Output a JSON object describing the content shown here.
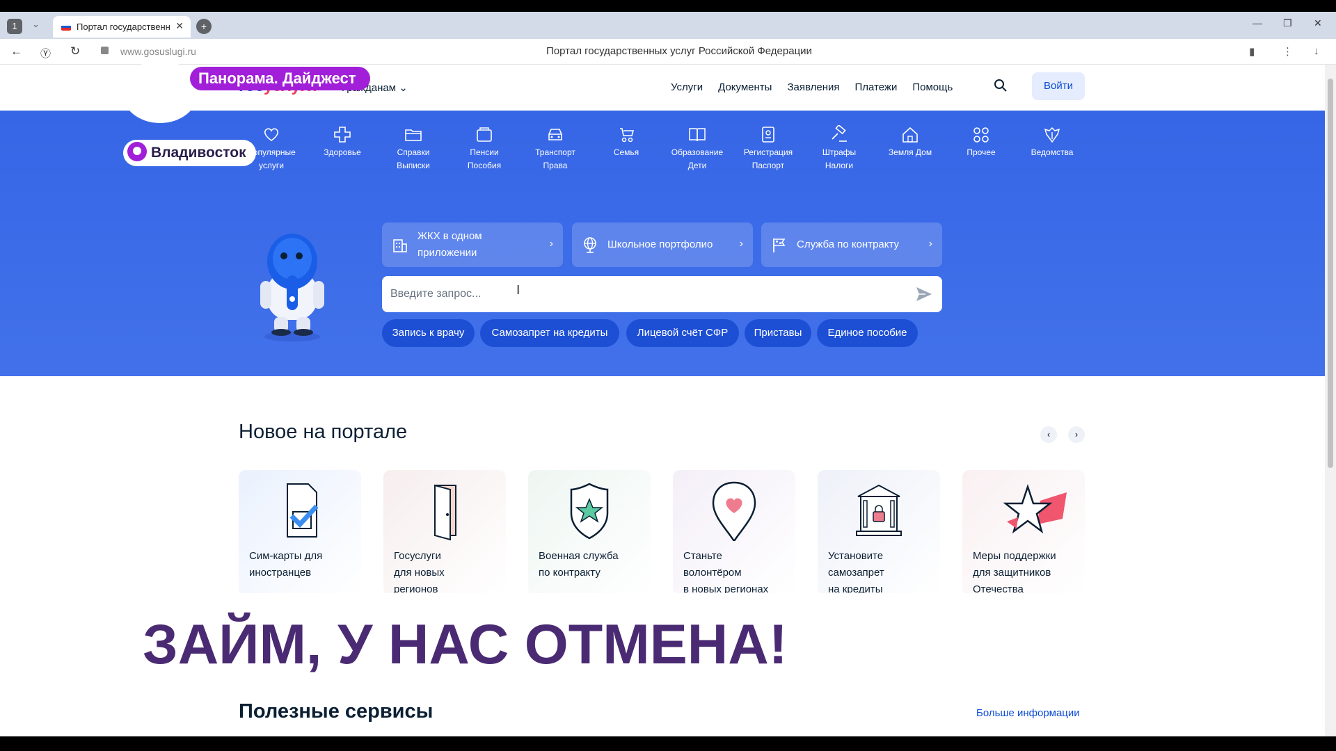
{
  "browser": {
    "tab_count": "1",
    "tab_title": "Портал государственн",
    "url": "www.gosuslugi.ru",
    "page_title": "Портал государственных услуг Российской Федерации"
  },
  "overlay": {
    "show_name": "Панорама. Дайджест",
    "city": "Владивосток",
    "headline": "ЗАЙМ, У НАС ОТМЕНА!"
  },
  "header": {
    "logo_part1": "гос",
    "logo_part2": "услуги",
    "audience": "Гражданам",
    "nav": [
      "Услуги",
      "Документы",
      "Заявления",
      "Платежи",
      "Помощь"
    ],
    "login": "Войти"
  },
  "categories": [
    {
      "line1": "Популярные",
      "line2": "услуги",
      "icon": "heart-icon"
    },
    {
      "line1": "Здоровье",
      "line2": "",
      "icon": "health-cross-icon"
    },
    {
      "line1": "Справки",
      "line2": "Выписки",
      "icon": "folder-icon"
    },
    {
      "line1": "Пенсии",
      "line2": "Пособия",
      "icon": "wallet-icon"
    },
    {
      "line1": "Транспорт",
      "line2": "Права",
      "icon": "car-icon"
    },
    {
      "line1": "Семья",
      "line2": "",
      "icon": "stroller-icon"
    },
    {
      "line1": "Образование",
      "line2": "Дети",
      "icon": "book-icon"
    },
    {
      "line1": "Регистрация",
      "line2": "Паспорт",
      "icon": "passport-icon"
    },
    {
      "line1": "Штрафы",
      "line2": "Налоги",
      "icon": "gavel-icon"
    },
    {
      "line1": "Земля Дом",
      "line2": "",
      "icon": "house-icon"
    },
    {
      "line1": "Прочее",
      "line2": "",
      "icon": "grid-icon"
    },
    {
      "line1": "Ведомства",
      "line2": "",
      "icon": "emblem-icon"
    }
  ],
  "promos": [
    {
      "line1": "ЖКХ в одном",
      "line2": "приложении",
      "icon": "building-icon"
    },
    {
      "line1": "Школьное портфолио",
      "line2": "",
      "icon": "globe-icon"
    },
    {
      "line1": "Служба по контракту",
      "line2": "",
      "icon": "flag-icon"
    }
  ],
  "search": {
    "placeholder": "Введите запрос..."
  },
  "quick_chips": [
    "Запись к врачу",
    "Самозапрет на кредиты",
    "Лицевой счёт СФР",
    "Приставы",
    "Единое пособие"
  ],
  "news": {
    "title": "Новое на портале",
    "cards": [
      {
        "lines": [
          "Сим-карты для",
          "иностранцев",
          ""
        ],
        "bg": "#eaf1fd",
        "icon": "sim-card-icon"
      },
      {
        "lines": [
          "Госуслуги",
          "для новых",
          "регионов"
        ],
        "bg": "#f7eeee",
        "icon": "door-icon"
      },
      {
        "lines": [
          "Военная служба",
          "по контракту",
          ""
        ],
        "bg": "#eef6f2",
        "icon": "shield-star-icon"
      },
      {
        "lines": [
          "Станьте",
          "волонтёром",
          "в новых регионах"
        ],
        "bg": "#f4eff8",
        "icon": "heart-pin-icon"
      },
      {
        "lines": [
          "Установите",
          "самозапрет",
          "на кредиты"
        ],
        "bg": "#eef1f9",
        "icon": "bank-lock-icon"
      },
      {
        "lines": [
          "Меры поддержки",
          "для защитников",
          "Отечества"
        ],
        "bg": "#f9f0f2",
        "icon": "star-ribbon-icon"
      }
    ]
  },
  "useful": {
    "title": "Полезные сервисы",
    "more": "Больше информации"
  },
  "colors": {
    "brand_blue": "#0d4cd3",
    "hero_blue": "#3666e6",
    "chip_blue": "#1d4fd4",
    "accent_purple": "#a11fd8",
    "headline_purple": "#4a2a72"
  }
}
